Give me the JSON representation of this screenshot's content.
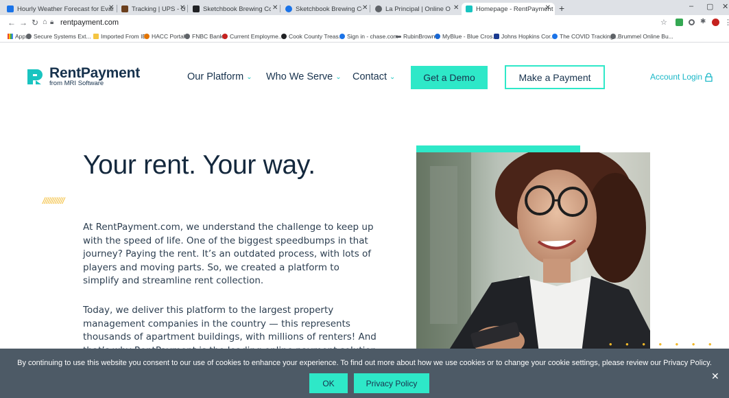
{
  "browser": {
    "tabs": [
      {
        "label": "Hourly Weather Forecast for Evan",
        "color": "#1a73e8"
      },
      {
        "label": "Tracking | UPS - United States",
        "color": "#6b3f1d"
      },
      {
        "label": "Sketchbook Brewing Co.",
        "color": "#202124"
      },
      {
        "label": "Sketchbook Brewing Co. - Evanst",
        "color": "#1a73e8"
      },
      {
        "label": "La Principal | Online Ordering",
        "color": "#5f6368"
      },
      {
        "label": "Homepage - RentPayment",
        "color": "#19c4c0"
      }
    ],
    "new_tab": "+",
    "win_min": "–",
    "win_max": "▢",
    "win_close": "✕",
    "url": "rentpayment.com",
    "bookmarks": [
      {
        "label": "Apps",
        "color": "#5f6368"
      },
      {
        "label": "Secure Systems Ext...",
        "color": "#5f6368"
      },
      {
        "label": "Imported From IE",
        "color": "#f4c542"
      },
      {
        "label": "HACC Portal",
        "color": "#e37400"
      },
      {
        "label": "FNBC Bank",
        "color": "#5f6368"
      },
      {
        "label": "Current Employme...",
        "color": "#c5221f"
      },
      {
        "label": "Cook County Treas...",
        "color": "#202124"
      },
      {
        "label": "Sign in - chase.com",
        "color": "#1a73e8"
      },
      {
        "label": "RubinBrown",
        "color": "#5f6368"
      },
      {
        "label": "MyBlue - Blue Cros...",
        "color": "#1967d2"
      },
      {
        "label": "Johns Hopkins Cor...",
        "color": "#1a3a8f"
      },
      {
        "label": "The COVID Tracking...",
        "color": "#1a73e8"
      },
      {
        "label": "Brummel Online Bu...",
        "color": "#5f6368"
      }
    ]
  },
  "site": {
    "logo_name": "RentPayment",
    "logo_sub": "from MRI Software",
    "nav": {
      "platform": "Our Platform",
      "who": "Who We Serve",
      "contact": "Contact",
      "demo": "Get a Demo",
      "pay": "Make a Payment",
      "login": "Account Login"
    },
    "accent": "#2ee8c8",
    "navy": "#17324d"
  },
  "hero": {
    "title": "Your rent. Your way.",
    "hatch": "////////////",
    "para1": "At RentPayment.com, we understand the challenge to keep up with the speed of life. One of the biggest speedbumps in that journey? Paying the rent. It’s an outdated process, with lots of players and moving parts. So, we created a platform to simplify and streamline rent collection.",
    "para2": "Today, we deliver this platform to the largest property management companies in the country — this represents thousands of apartment buildings, with millions of renters! And that’s why RentPayment is the leading online payment solution"
  },
  "cookie": {
    "text": "By continuing to use this website you consent to our use of cookies to enhance your experience. To find out more about how we use cookies or to change your cookie settings, please review our Privacy Policy.",
    "ok": "OK",
    "privacy": "Privacy Policy",
    "close": "✕"
  }
}
